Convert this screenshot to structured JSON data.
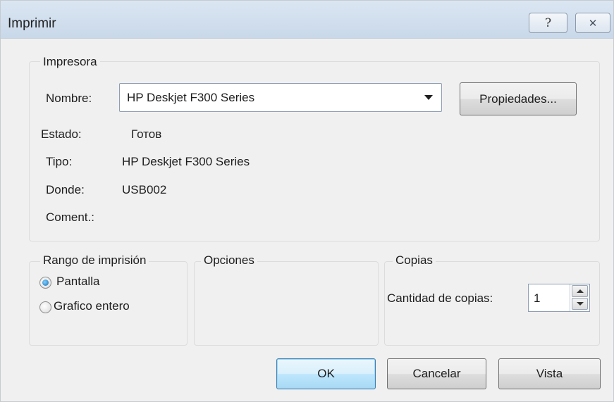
{
  "window": {
    "title": "Imprimir",
    "help_glyph": "?",
    "close_glyph": "✕"
  },
  "printer_group": {
    "legend": "Impresora",
    "name_label": "Nombre:",
    "selected_printer": "HP Deskjet F300 Series",
    "properties_button": "Propiedades...",
    "status_label": "Estado:",
    "status_value": "Готов",
    "type_label": "Tipo:",
    "type_value": "HP Deskjet F300 Series",
    "where_label": "Donde:",
    "where_value": "USB002",
    "comment_label": "Coment.:",
    "comment_value": ""
  },
  "range_group": {
    "legend": "Rango de imprisión",
    "options": [
      {
        "label": "Pantalla",
        "checked": true
      },
      {
        "label": "Grafico entero",
        "checked": false
      }
    ]
  },
  "options_group": {
    "legend": "Opciones"
  },
  "copies_group": {
    "legend": "Copias",
    "count_label": "Cantidad de copias:",
    "count_value": "1"
  },
  "footer": {
    "ok_button": "OK",
    "cancel_button": "Cancelar",
    "preview_button": "Vista"
  }
}
